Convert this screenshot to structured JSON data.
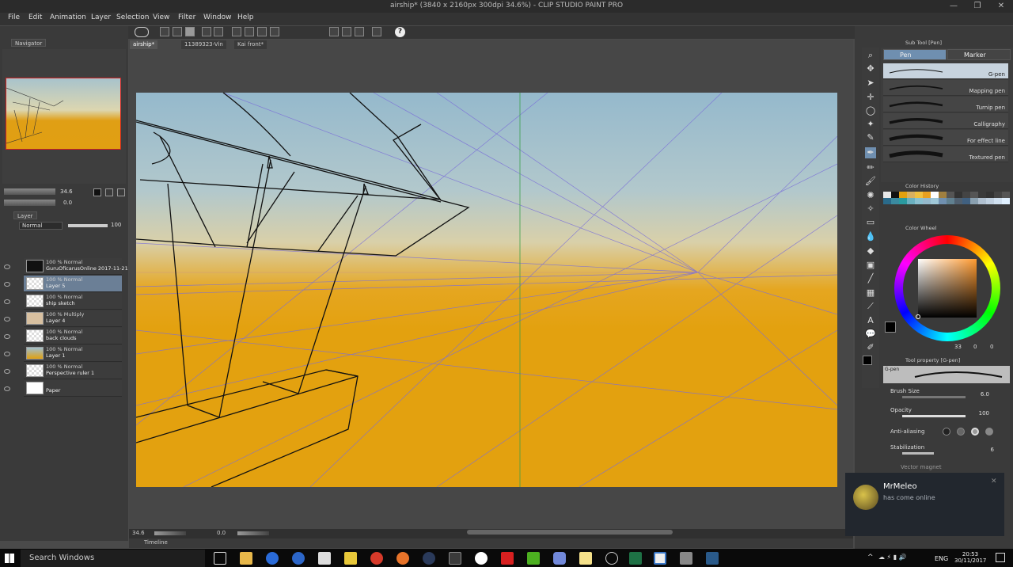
{
  "window": {
    "title": "airship* (3840 x 2160px 300dpi 34.6%) - CLIP STUDIO PAINT PRO"
  },
  "menu": [
    "File",
    "Edit",
    "Animation",
    "Layer",
    "Selection",
    "View",
    "Filter",
    "Window",
    "Help"
  ],
  "navigator": {
    "tab": "Navigator",
    "zoom": "34.6",
    "rotation": "0.0"
  },
  "layer_panel": {
    "tab": "Layer",
    "blend_mode": "Normal",
    "opacity": "100",
    "layers": [
      {
        "line1": "100 % Normal",
        "line2": "GuruOficarusOnline 2017-11-21 18-4",
        "selected": false
      },
      {
        "line1": "100 % Normal",
        "line2": "Layer 5",
        "selected": true
      },
      {
        "line1": "100 % Normal",
        "line2": "ship sketch",
        "selected": false
      },
      {
        "line1": "100 % Multiply",
        "line2": "Layer 4",
        "selected": false
      },
      {
        "line1": "100 % Normal",
        "line2": "back clouds",
        "selected": false
      },
      {
        "line1": "100 % Normal",
        "line2": "Layer 1",
        "selected": false
      },
      {
        "line1": "100 % Normal",
        "line2": "Perspective ruler 1",
        "selected": false
      },
      {
        "line1": "",
        "line2": "Paper",
        "selected": false
      }
    ]
  },
  "doc_tabs": [
    "airship*",
    "11389323-Vin",
    "Kai front*"
  ],
  "status": {
    "zoom": "34.6",
    "rotation": "0.0"
  },
  "timeline": {
    "tab": "Timeline"
  },
  "sub_tool": {
    "header": "Sub Tool [Pen]",
    "tabs": [
      "Pen",
      "Marker"
    ],
    "brushes": [
      "G-pen",
      "Mapping pen",
      "Turnip pen",
      "Calligraphy",
      "For effect line",
      "Textured pen"
    ]
  },
  "color_history": {
    "header": "Color History"
  },
  "color_wheel": {
    "header": "Color Wheel",
    "values": [
      "33",
      "0",
      "0"
    ]
  },
  "tool_property": {
    "header": "Tool property [G-pen]",
    "preset": "G-pen",
    "brush_size": {
      "label": "Brush Size",
      "value": "6.0"
    },
    "opacity": {
      "label": "Opacity",
      "value": "100"
    },
    "anti_aliasing": {
      "label": "Anti-aliasing"
    },
    "stabilization": {
      "label": "Stabilization",
      "value": "6"
    },
    "vector_magnet": {
      "label": "Vector magnet"
    }
  },
  "toast": {
    "name": "MrMeleo",
    "message": "has come online"
  },
  "taskbar": {
    "search": "Search Windows",
    "lang": "ENG",
    "time": "20:53",
    "date": "30/11/2017"
  },
  "colors": {
    "sky_top": "#95b9cc",
    "sky_horizon": "#d9d0a9",
    "ground": "#e3a10f",
    "perspective_line": "#7b6fd8",
    "selection": "#6b7f96"
  }
}
